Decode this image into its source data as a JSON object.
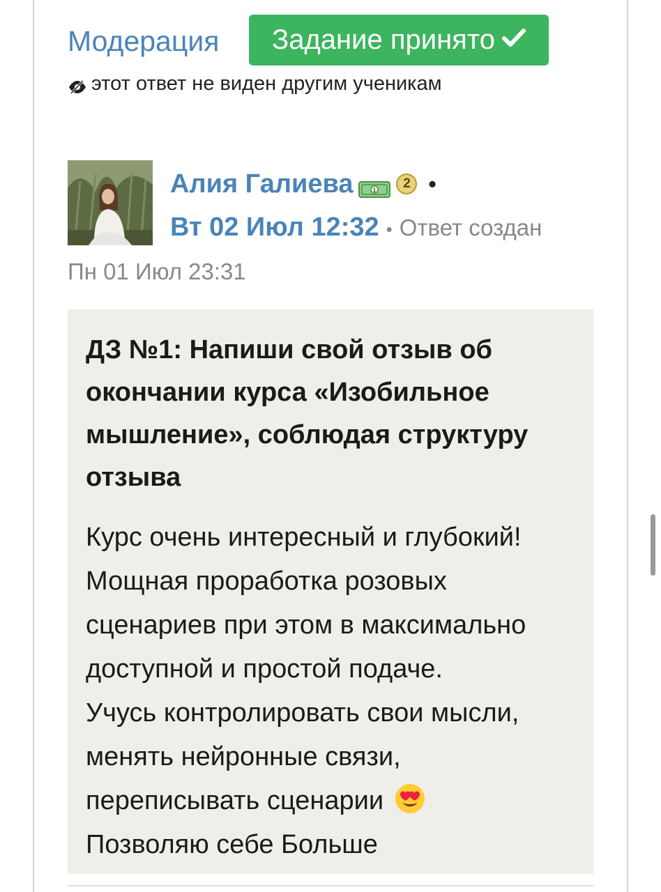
{
  "moderation": {
    "link_label": "Модерация",
    "status_label": "Задание принято",
    "status_color": "#3db45e",
    "check_icon": "check-icon"
  },
  "visibility_note": {
    "icon": "eye-off-icon",
    "text": "этот ответ не виден другим ученикам"
  },
  "author": {
    "name": "Алия Галиева",
    "money_icon": "money-bill-icon",
    "level": "2",
    "separator": "•",
    "accepted_at": "Вт 02 Июл 12:32",
    "created_separator": "•",
    "created_label": "Ответ создан",
    "created_at": "Пн 01 Июл 23:31"
  },
  "answer": {
    "title": "ДЗ №1: Напиши свой отзыв об окончании курса «Изобильное мышление», соблюдая структуру отзыва",
    "lines": [
      "Курс очень интересный и глубокий!",
      "Мощная проработка розовых",
      "сценариев при этом в максимально",
      "доступной и простой подаче.",
      "Учусь контролировать свои мысли,",
      "менять нейронные связи,",
      "переписывать сценарии",
      "Позволяю себе Больше"
    ],
    "emoji_icon": "heart-eyes-emoji-icon",
    "background": "#efeee8"
  },
  "colors": {
    "link": "#4a84b8",
    "muted": "#888888"
  }
}
